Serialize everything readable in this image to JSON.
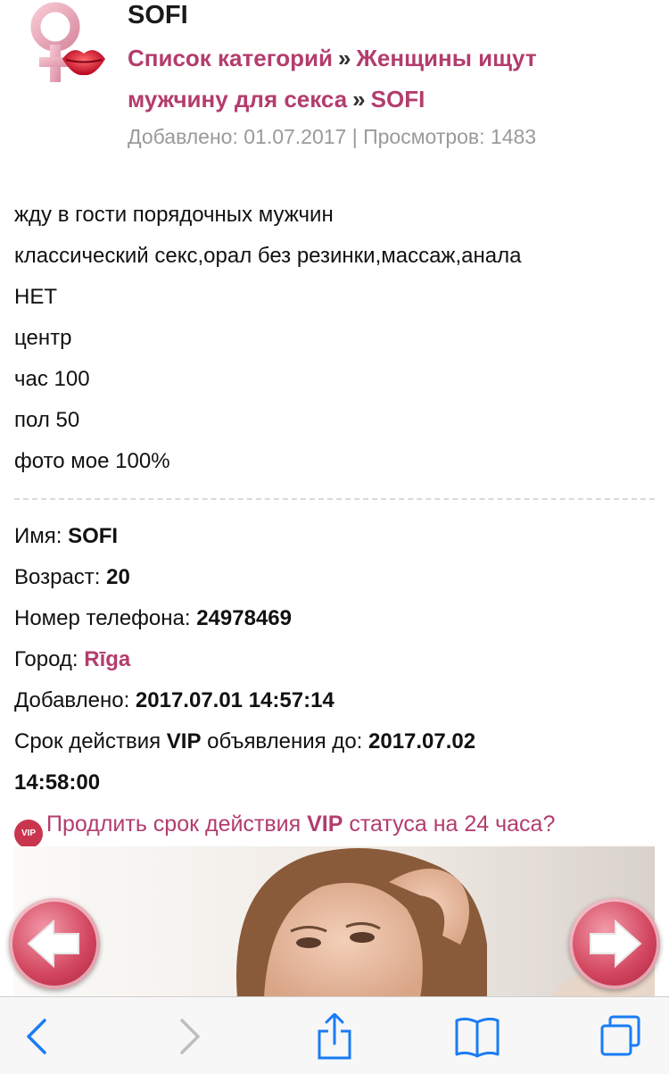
{
  "header": {
    "title": "SOFI",
    "breadcrumb": {
      "items": [
        "Список категорий",
        "Женщины ищут",
        "мужчину для секса",
        "SOFI"
      ],
      "separator": "»"
    },
    "meta": "Добавлено: 01.07.2017 | Просмотров: 1483"
  },
  "description": {
    "lines": [
      "жду в гости порядочных мужчин",
      "классический секс,орал без резинки,массаж,анала",
      "НЕТ",
      "центр",
      "час 100",
      "пол 50",
      "фото мое 100%"
    ]
  },
  "info": {
    "name_label": "Имя:",
    "name_value": "SOFI",
    "age_label": "Возраст:",
    "age_value": "20",
    "phone_label": "Номер телефона:",
    "phone_value": "24978469",
    "city_label": "Город:",
    "city_value": "Rīga",
    "added_label": "Добавлено:",
    "added_value": "2017.07.01 14:57:14",
    "vip_expiry_label_1": "Срок действия",
    "vip_expiry_vip": "VIP",
    "vip_expiry_label_2": "объявления до:",
    "vip_expiry_date": "2017.07.02",
    "vip_expiry_time": "14:58:00"
  },
  "vip_extend": {
    "badge": "VIP",
    "text_1": "Продлить срок действия",
    "text_vip": "VIP",
    "text_2": "статуса на 24 часа?"
  },
  "gallery": {
    "prev_icon": "arrow-left-icon",
    "next_icon": "arrow-right-icon"
  },
  "toolbar": {
    "icons": [
      "back-icon",
      "forward-icon",
      "share-icon",
      "bookmarks-icon",
      "tabs-icon"
    ]
  },
  "colors": {
    "accent": "#b33d6c",
    "meta_gray": "#9a9a9a",
    "ios_blue": "#1a7cf5",
    "vip_badge": "#c9354f"
  }
}
